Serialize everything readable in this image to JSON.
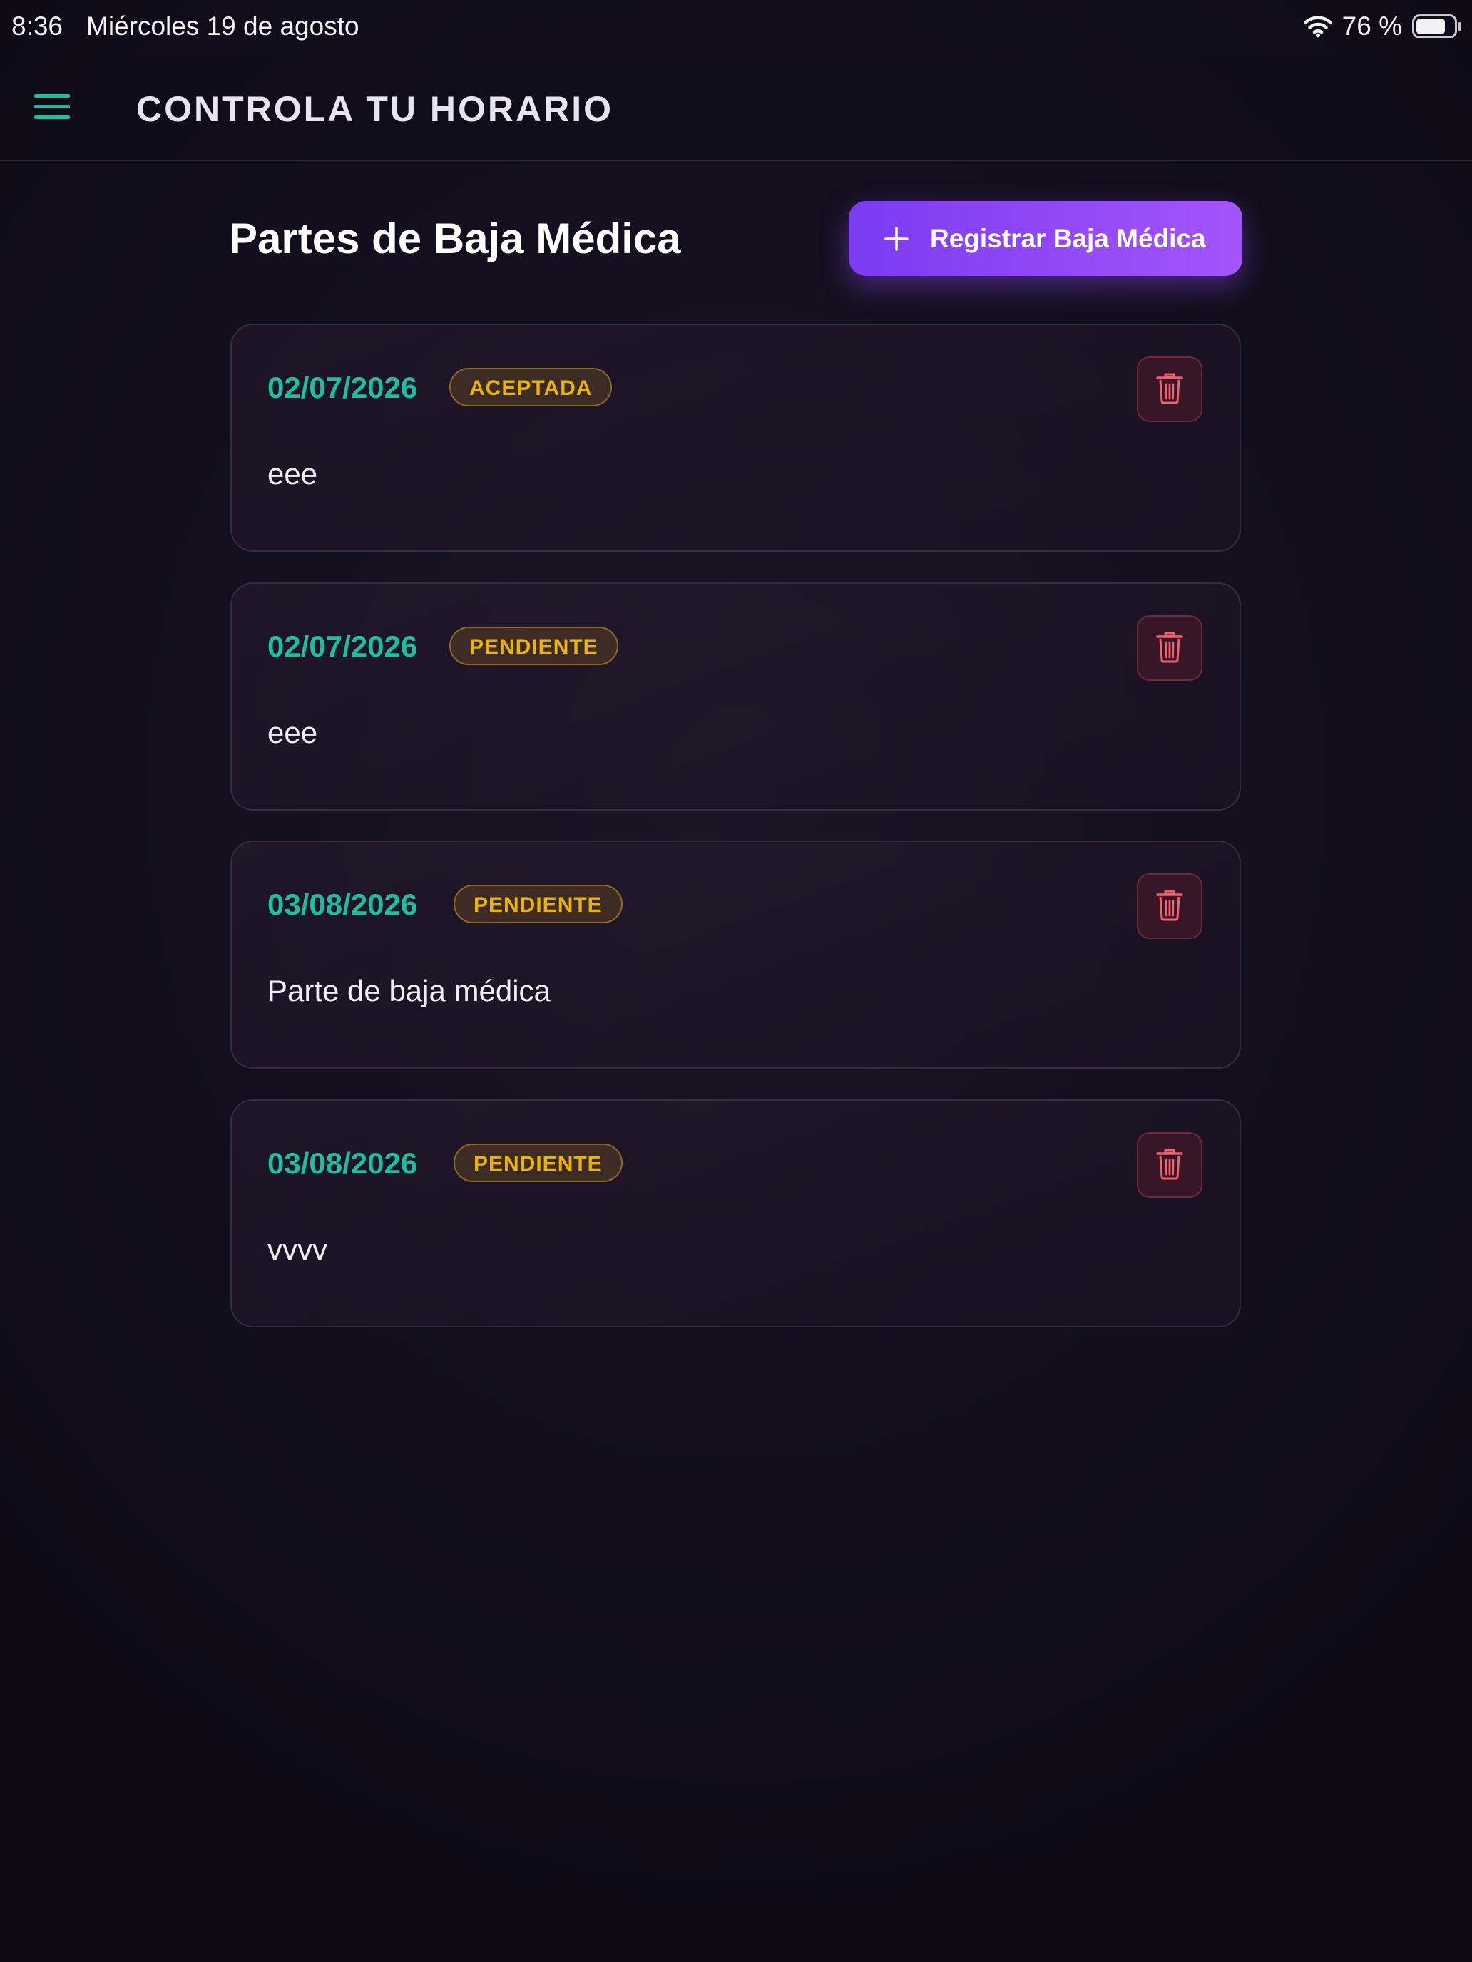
{
  "status_bar": {
    "time": "8:36",
    "date": "Miércoles 19 de agosto",
    "battery": "76 %",
    "icons": [
      "wifi-icon",
      "battery-icon"
    ]
  },
  "header": {
    "title": "CONTROLA TU HORARIO",
    "menu_icon": "hamburger-menu-icon"
  },
  "page": {
    "title": "Partes de Baja Médica",
    "register_button": "Registrar Baja Médica"
  },
  "records": [
    {
      "date": "02/07/2026",
      "status": "ACEPTADA",
      "description": "eee"
    },
    {
      "date": "02/07/2026",
      "status": "PENDIENTE",
      "description": "eee"
    },
    {
      "date": "03/08/2026",
      "status": "PENDIENTE",
      "description": "Parte de baja médica"
    },
    {
      "date": "03/08/2026",
      "status": "PENDIENTE",
      "description": "vvvv"
    }
  ],
  "colors": {
    "accent_teal": "#1dbf9e",
    "button_purple": "#8b45f5",
    "badge_amber": "#eab308",
    "delete_red": "#f0626f"
  }
}
